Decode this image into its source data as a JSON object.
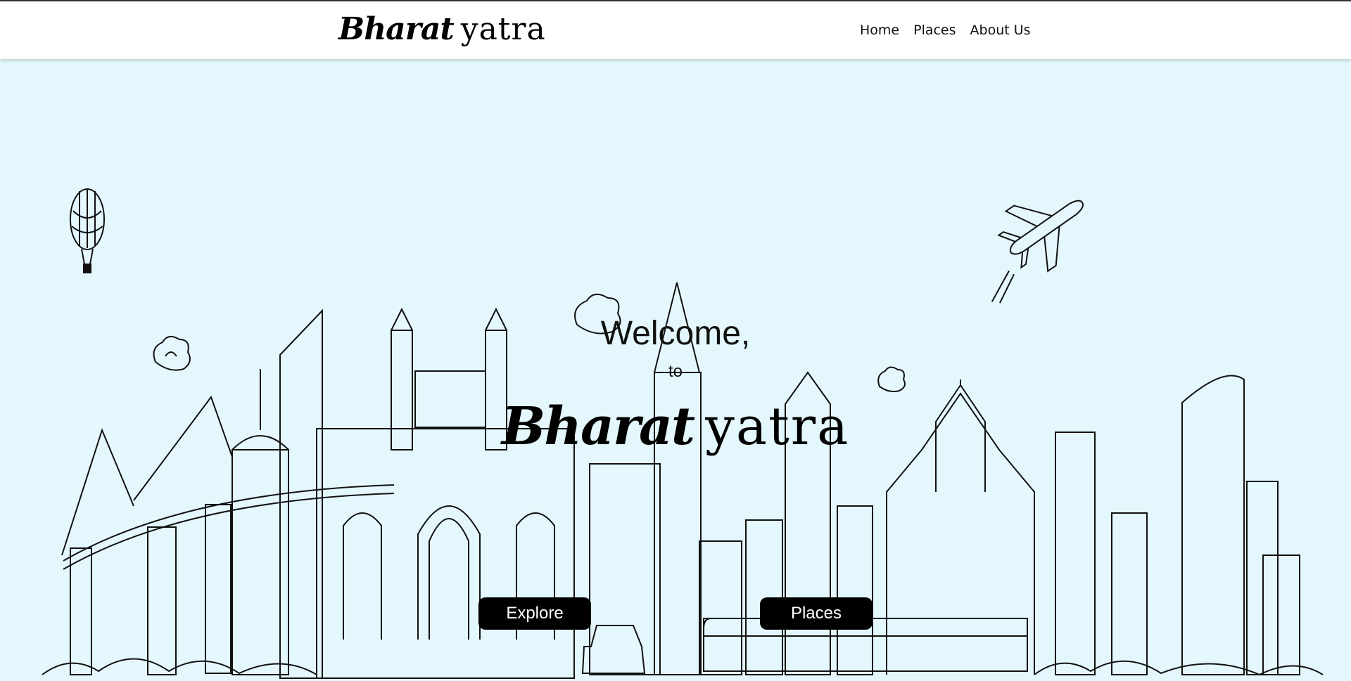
{
  "navbar": {
    "logo_bold": "Bharat",
    "logo_light": "yatra",
    "links": [
      "Home",
      "Places",
      "About Us"
    ]
  },
  "hero": {
    "welcome": "Welcome,",
    "to": "to",
    "title_bold": "Bharat",
    "title_light": "yatra",
    "buttons": {
      "explore": "Explore",
      "places": "Places"
    }
  },
  "colors": {
    "background": "#e4f7fc",
    "navbar": "#ffffff",
    "button": "#000000",
    "button_text": "#ffffff"
  },
  "icons": [
    "hot-air-balloon-icon",
    "airplane-icon",
    "cloud-icon",
    "city-skyline-illustration",
    "gateway-arch-illustration",
    "train-illustration",
    "taxi-illustration"
  ]
}
